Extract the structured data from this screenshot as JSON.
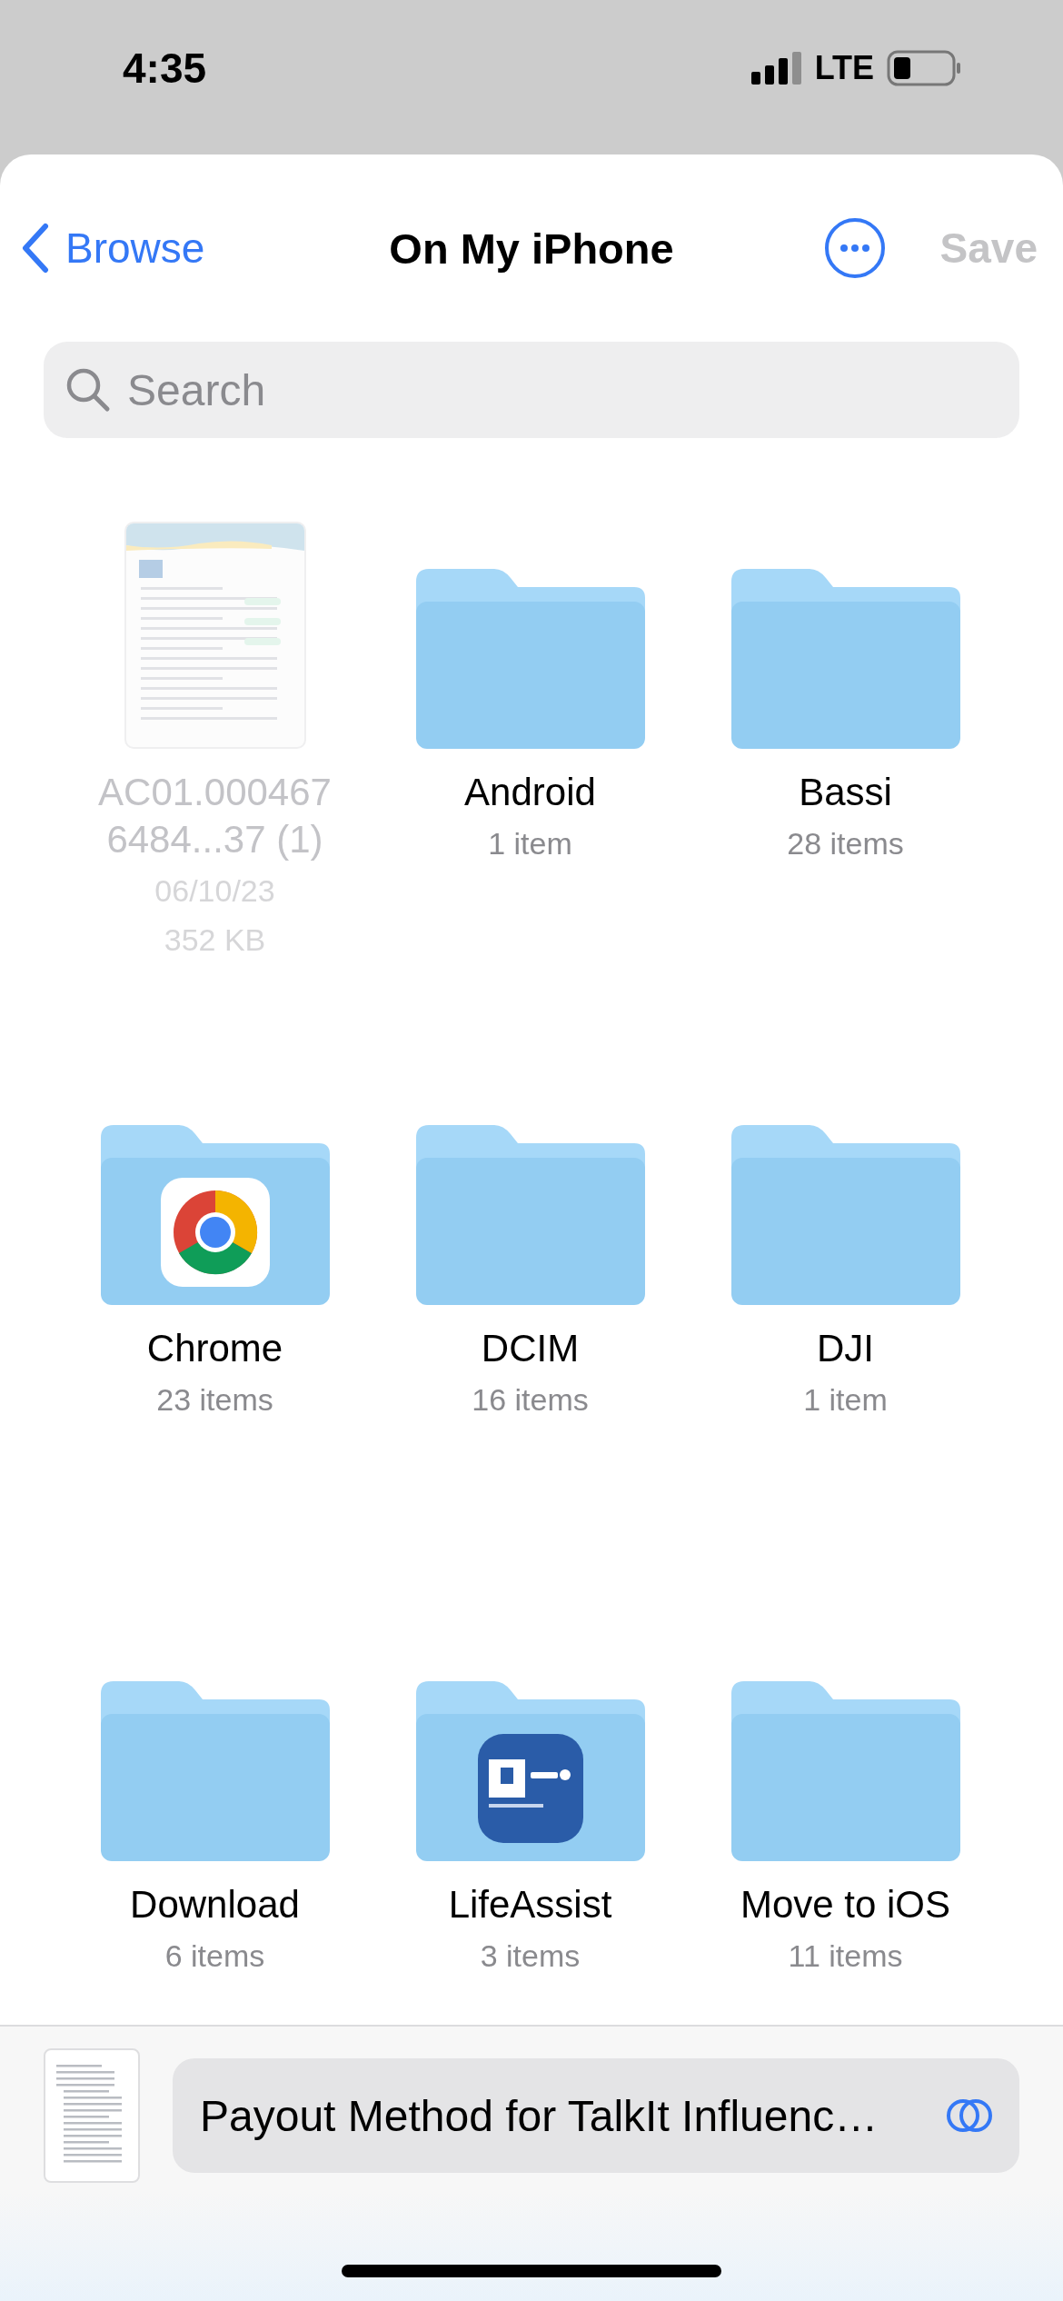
{
  "status_bar": {
    "time": "4:35",
    "network": "LTE"
  },
  "nav": {
    "back": "Browse",
    "title": "On My iPhone",
    "action": "Save",
    "action_disabled": true
  },
  "search": {
    "placeholder": "Search"
  },
  "items": [
    {
      "kind": "file",
      "name": "AC01.0004676484...37 (1)",
      "date": "06/10/23",
      "size": "352 KB",
      "disabled": true
    },
    {
      "kind": "folder",
      "name": "Android",
      "count": "1 item"
    },
    {
      "kind": "folder",
      "name": "Bassi",
      "count": "28 items"
    },
    {
      "kind": "browser-folder",
      "name": "Chrome",
      "count": "23 items"
    },
    {
      "kind": "folder",
      "name": "DCIM",
      "count": "16 items"
    },
    {
      "kind": "folder",
      "name": "DJI",
      "count": "1 item"
    },
    {
      "kind": "folder",
      "name": "Download",
      "count": "6 items"
    },
    {
      "kind": "insurance-folder",
      "name": "LifeAssist",
      "count": "3 items"
    },
    {
      "kind": "folder",
      "name": "Move to iOS",
      "count": "11 items"
    }
  ],
  "attachment": {
    "title": "Payout Method for TalkIt Influenc…"
  }
}
